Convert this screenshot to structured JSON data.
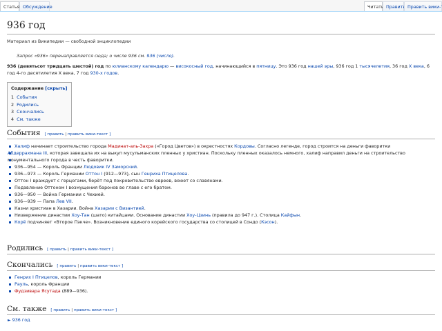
{
  "tabs": {
    "article": "Статья",
    "discussion": "Обсуждение",
    "read": "Читать",
    "edit": "Править",
    "edit_source": "Править вики-текст"
  },
  "title": "936 год",
  "subtitle": "Материал из Википедии — свободной энциклопедии",
  "hatnote": {
    "prefix": "Запрос «936» перенаправляется сюда; о числе 936 см.",
    "link": "936 (число)",
    "suffix": "."
  },
  "intro": {
    "bold": "936 (девятьсот тридцать шестой) год",
    "t1": " по ",
    "l1": "юлианскому календарю",
    "t2": " — ",
    "l2": "високосный год",
    "t3": ", начинающийся в ",
    "l3": "пятницу",
    "t4": ". Это 936 год ",
    "l4": "нашей эры",
    "t5": ", 936 год 1 ",
    "l5": "тысячелетия",
    "t6": ", 36 год ",
    "l6": "X века",
    "t7": ", 6 год 4-го десятилетия X века, 7 год ",
    "l7": "930-х годов",
    "t8": "."
  },
  "toc": {
    "title": "Содержание",
    "toggle": "[скрыть]",
    "items": [
      {
        "num": "1",
        "label": "События"
      },
      {
        "num": "2",
        "label": "Родились"
      },
      {
        "num": "3",
        "label": "Скончались"
      },
      {
        "num": "4",
        "label": "См. также"
      }
    ]
  },
  "edit_links": {
    "edit": "[ править",
    "sep": " | ",
    "source": "править вики-текст ]"
  },
  "sections": {
    "events": "События",
    "born": "Родились",
    "died": "Скончались",
    "see_also": "См. также"
  },
  "events": [
    {
      "a": "Халиф",
      "b": " начинает строительство города ",
      "c": "Мадинат-аль-Захра",
      "d": " («Город Цветов») в окрестностях ",
      "e": "Кордовы",
      "f": ". Согласно легенде, город строится на деньги фаворитки"
    },
    {
      "a": "Абдеррахмана III",
      "b": ", которая завещала их на выкуп мусульманских пленных у христиан. Поскольку пленных оказалось немного, халиф направил деньги на строительство"
    },
    {
      "a": "монументального города в честь фаворитки."
    },
    {
      "a": "936—954 — Король Франции ",
      "b": "Людовик IV Заморский",
      "c": "."
    },
    {
      "a": "936—973 — Король Германии ",
      "b": "Оттон I",
      "c": " (912—973), сын ",
      "d": "Генриха Птицелова",
      "e": "."
    },
    {
      "a": "Оттон I враждует с герцогами, берёт под покровительство евреев, воюет со славянами."
    },
    {
      "a": "Подавление Оттоном I возмущения баронов во главе с его братом."
    },
    {
      "a": "936—950 — Война Германии с Чехией."
    },
    {
      "a": "936—939 — Папа ",
      "b": "Лев VII",
      "c": "."
    },
    {
      "a": "Казни христиан в Хазарии. Война ",
      "b": "Хазарии с Византией",
      "c": "."
    },
    {
      "a": "Низвержение династии ",
      "b": "Хоу-Тан",
      "c": " (шато) китайцами. Основание династии ",
      "d": "Хоу-Цзинь",
      "e": " (правила до 947 г.). Столица ",
      "f": "Кайфын",
      "g": "."
    },
    {
      "a": "Корё",
      "b": " подчиняет «Второе Пэкче». Возникновение единого корейского государства со столицей в Сондо (",
      "c": "Кэсон",
      "d": ")."
    }
  ],
  "died": [
    {
      "a": "Генрих I Птицелов",
      "b": ", король Германии"
    },
    {
      "a": "Рауль",
      "b": ", король Франции"
    },
    {
      "a": "Фудзивара Ясутада",
      "b": " (889—936)."
    }
  ],
  "see_also_item": "936 год",
  "colors": {
    "link": "#0645ad",
    "redlink": "#ba0000",
    "border": "#aaa",
    "background": "#f6f6f6"
  }
}
